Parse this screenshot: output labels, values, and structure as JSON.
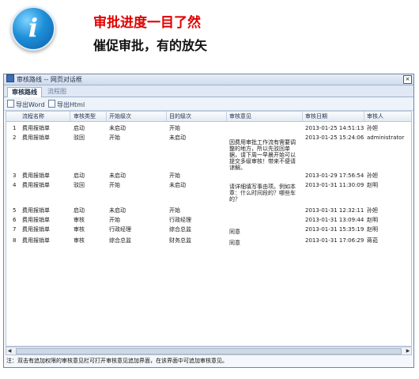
{
  "header": {
    "headline": "审批进度一目了然",
    "subline": "催促审批，有的放矢"
  },
  "dialog": {
    "title": "审核路线 -- 网页对话框",
    "close_glyph": "×",
    "tabs": [
      "审核路线",
      "流程图"
    ],
    "toolbar": [
      "导出Word",
      "导出Html"
    ],
    "columns": [
      "流程名称",
      "审核类型",
      "开始级次",
      "目的级次",
      "审核意见",
      "审核日期",
      "审核人"
    ],
    "rows": [
      {
        "no": "1",
        "name": "费用报销单",
        "type": "启动",
        "from": "未启动",
        "to": "开始",
        "opinion": "",
        "date": "2013-01-25 14:51:13",
        "user": "孙妲"
      },
      {
        "no": "2",
        "name": "费用报销单",
        "type": "驳回",
        "from": "开始",
        "to": "未启动",
        "opinion": "因费用审批工作流有需要调整的地方，所以先驳回单据，请下周一早晨开始可以提交多级审核！带来不便请谅解。",
        "date": "2013-01-25 15:24:06",
        "user": "administrator"
      },
      {
        "no": "3",
        "name": "费用报销单",
        "type": "启动",
        "from": "未启动",
        "to": "开始",
        "opinion": "",
        "date": "2013-01-29 17:56:54",
        "user": "孙妲"
      },
      {
        "no": "4",
        "name": "费用报销单",
        "type": "驳回",
        "from": "开始",
        "to": "未启动",
        "opinion": "请详细填写事由项。例如本章：什么时间段的？哪些车的？",
        "date": "2013-01-31 11:30:09",
        "user": "赵明"
      },
      {
        "no": "5",
        "name": "费用报销单",
        "type": "启动",
        "from": "未启动",
        "to": "开始",
        "opinion": "",
        "date": "2013-01-31 12:32:11",
        "user": "孙妲"
      },
      {
        "no": "6",
        "name": "费用报销单",
        "type": "审核",
        "from": "开始",
        "to": "行政经理",
        "opinion": "",
        "date": "2013-01-31 13:09:44",
        "user": "赵明"
      },
      {
        "no": "7",
        "name": "费用报销单",
        "type": "审核",
        "from": "行政经理",
        "to": "综合总监",
        "opinion": "同意",
        "date": "2013-01-31 15:35:19",
        "user": "赵明"
      },
      {
        "no": "8",
        "name": "费用报销单",
        "type": "审核",
        "from": "综合总监",
        "to": "财务总监",
        "opinion": "同意",
        "date": "2013-01-31 17:06:29",
        "user": "蒋茹"
      }
    ],
    "note": "注：双击有追加权限的审核意见栏可打开审核意见追加界面，在该界面中可追加审核意见。"
  },
  "icons": {
    "info": "info-icon",
    "close": "close-icon",
    "export": "document-icon"
  },
  "colors": {
    "headline": "#e10000",
    "accent": "#1e8fd8",
    "titlebar": "#cfdbeb"
  }
}
